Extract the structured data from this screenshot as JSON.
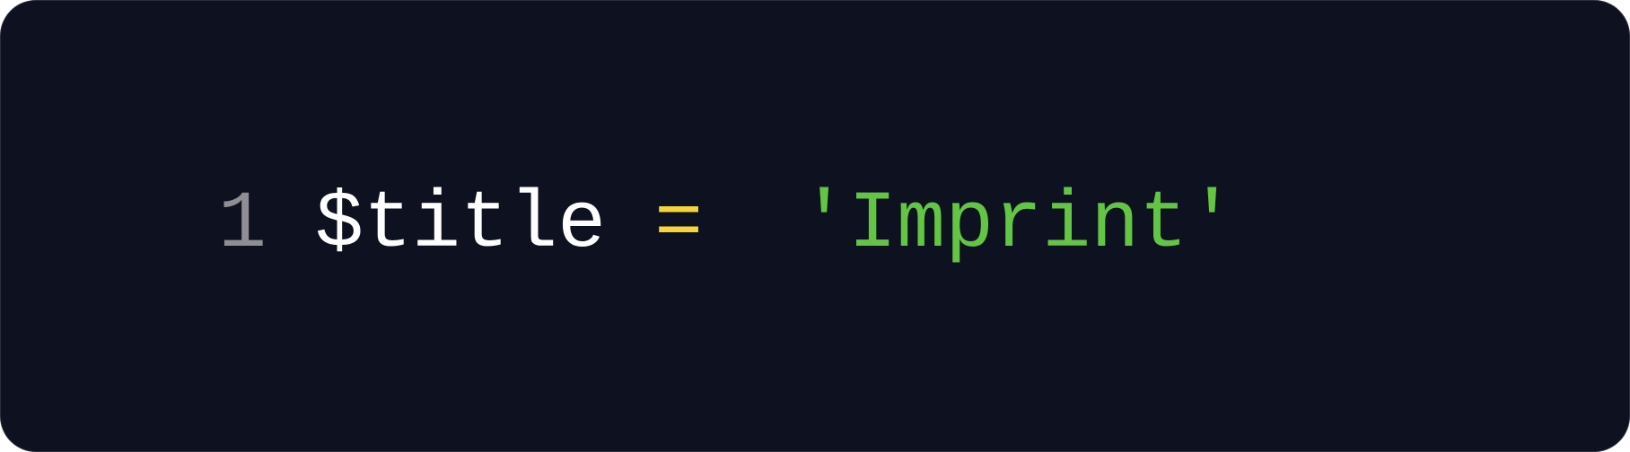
{
  "editor": {
    "background": "#0d1120",
    "line": {
      "number": "1",
      "tokens": {
        "variable": "$title",
        "operator": "=",
        "string": "'Imprint'"
      }
    },
    "colors": {
      "line_number": "#8e8e94",
      "variable": "#ffffff",
      "operator": "#f5d53a",
      "string": "#64c545"
    }
  }
}
